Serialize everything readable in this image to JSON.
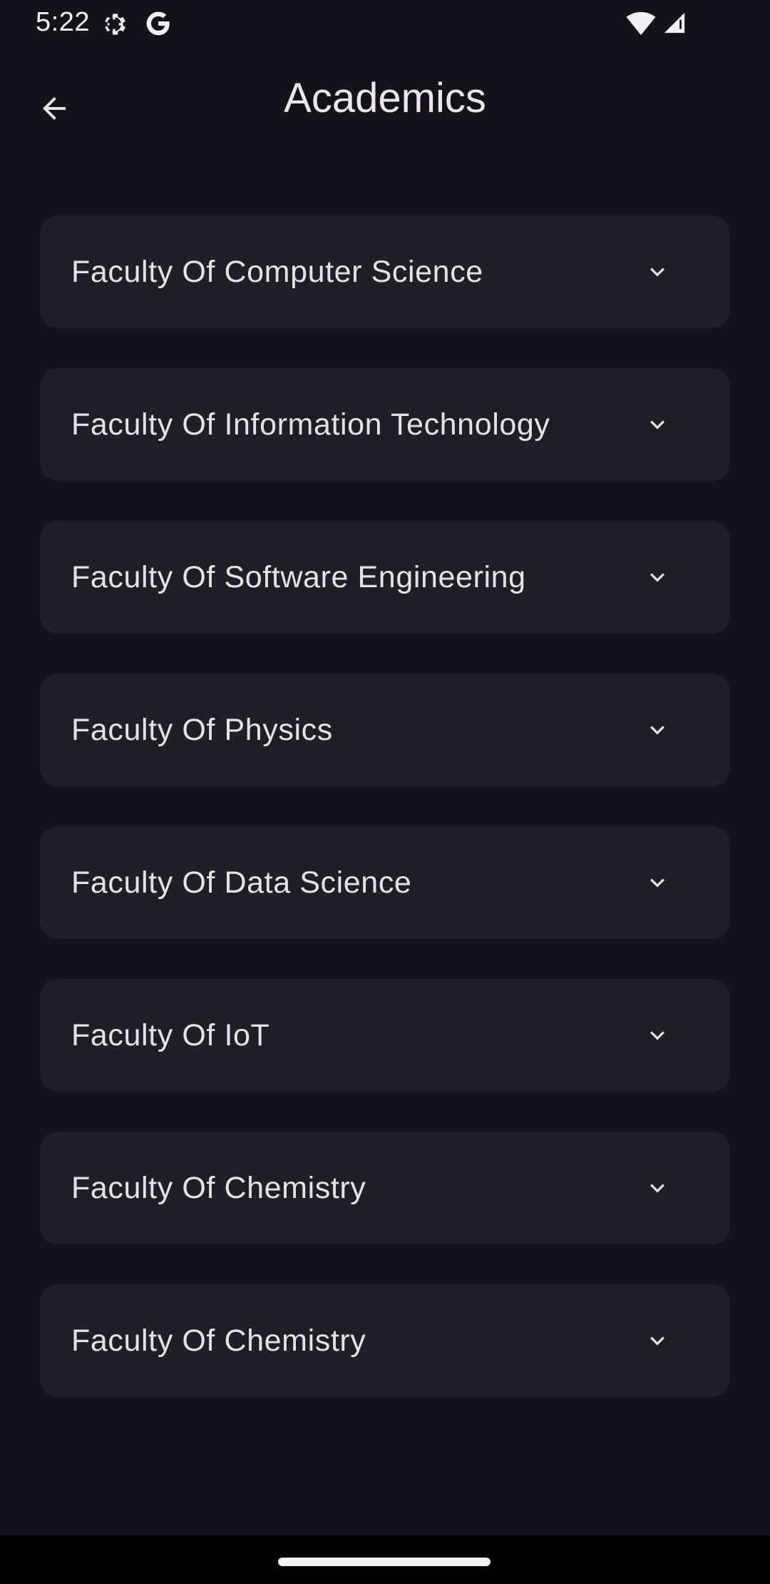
{
  "status_bar": {
    "time": "5:22",
    "icons": [
      "settings-icon",
      "google-icon",
      "wifi-icon",
      "signal-icon"
    ]
  },
  "app_bar": {
    "title": "Academics",
    "back_icon": "arrow-back-icon"
  },
  "faculties": [
    {
      "label": "Faculty Of Computer Science",
      "icon": "chevron-down-icon"
    },
    {
      "label": "Faculty Of Information Technology",
      "icon": "chevron-down-icon"
    },
    {
      "label": "Faculty Of Software Engineering",
      "icon": "chevron-down-icon"
    },
    {
      "label": "Faculty Of Physics",
      "icon": "chevron-down-icon"
    },
    {
      "label": "Faculty Of Data Science",
      "icon": "chevron-down-icon"
    },
    {
      "label": "Faculty Of IoT",
      "icon": "chevron-down-icon"
    },
    {
      "label": "Faculty Of Chemistry",
      "icon": "chevron-down-icon"
    },
    {
      "label": "Faculty Of Chemistry",
      "icon": "chevron-down-icon"
    }
  ],
  "colors": {
    "background": "#15131a",
    "card": "#211f26",
    "text": "#e6e1e8",
    "nav_bar": "#000000"
  }
}
